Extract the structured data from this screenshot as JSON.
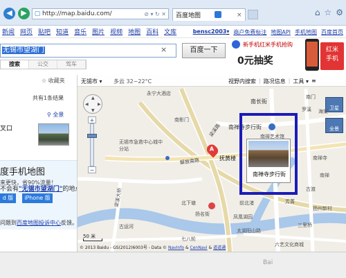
{
  "browser": {
    "url": "http://map.baidu.com/",
    "tab_title": "百度地图",
    "tab_close": "×",
    "back_icon": "back-arrow-icon",
    "forward_icon": "forward-arrow-icon",
    "address_tools": "⊘ ▾ ↻ ✕",
    "icons": [
      "home-icon",
      "star-icon",
      "gear-icon"
    ]
  },
  "top_nav": {
    "links": [
      "新闻",
      "网页",
      "贴吧",
      "知道",
      "音乐",
      "图片",
      "视频",
      "地图",
      "百科",
      "文库"
    ],
    "user": "bensc2003",
    "user_arrow": "▾",
    "right_links": [
      "商户免费标注",
      "地图API",
      "手机地图",
      "百度首页"
    ]
  },
  "search": {
    "value": "无锡市望湖门",
    "clear": "×",
    "button": "百度一下",
    "modes": [
      "搜索",
      "公交",
      "驾车"
    ],
    "active_mode": "搜索"
  },
  "ad": {
    "top_text": "新手机红米手机抢购",
    "big_text": "0元抽奖",
    "badge_line1": "红米",
    "badge_line2": "手机",
    "colors": {
      "accent": "#e23434"
    }
  },
  "sidebar": {
    "favorite": "☆ 收藏夹",
    "result_count": "共有1条结果",
    "panorama_link": "全景",
    "result_name": "叉口",
    "notice_prefix": "不会有",
    "notice_bold": "\"无锡市望湖门\"",
    "notice_suffix": "的地点?",
    "promo_title": "度手机地图",
    "promo_sub": "来更快，省90%流量！",
    "android_btn": "d 版",
    "iphone_btn": "iPhone 版",
    "feedback_text": "问题到",
    "feedback_link": "百度地图投诉中心",
    "feedback_suffix": "反馈。"
  },
  "map": {
    "city": "无锡市 ▾",
    "weather": "多云 32~22°C",
    "tools": [
      "视野内搜索",
      "路况信息",
      "工具 ▾",
      "≡"
    ],
    "map_types": [
      "卫星",
      "全景"
    ],
    "pan_dirs": [
      "▲",
      "▼",
      "◀",
      "▶"
    ],
    "zoom_in": "+",
    "zoom_out": "−",
    "marker_letter": "A",
    "marker_label": "抚黄楼",
    "photo_caption": "南禅寺步行街",
    "photo_note": "南禅寺步行街",
    "scale": "50 米",
    "copyright": "© 2013 Baidu - GS(2012)6003号 - Data ©",
    "copyright_links": [
      "NavInfo",
      "CenNavi",
      "道道通"
    ],
    "labels": {
      "nanchang_road": "南长街",
      "nanchan_street": "南禅寺步行街",
      "jiefang_road": "解放南路",
      "liangxi_road": "梁溪路",
      "nanmen": "南门",
      "art_store": "南禅艺术馆",
      "clinic": "无锡市急救中心城中分站",
      "nanyin": "南影门",
      "haitang": "海棠",
      "nanchan_temple": "南禅寺",
      "luoxi": "罗溪",
      "gudu": "古渡",
      "yangzhou": "扬州新村",
      "fangjin": "芳菁",
      "nanchang": "南禅",
      "north_stream": "前北渚",
      "liangxi_bridge": "梁溪大桥",
      "seven_eight": "七八轮",
      "yangzhou_lane": "扬名街",
      "hotel": "凤凰湖园",
      "liuxing": "北下塘",
      "river": "古运河",
      "shengxing": "六艺文化商城",
      "taihu": "太湖阳山路",
      "sanlixiao": "三里桥",
      "youai": "永宁大酒店"
    }
  },
  "bottom": {
    "tail": "Bai"
  }
}
